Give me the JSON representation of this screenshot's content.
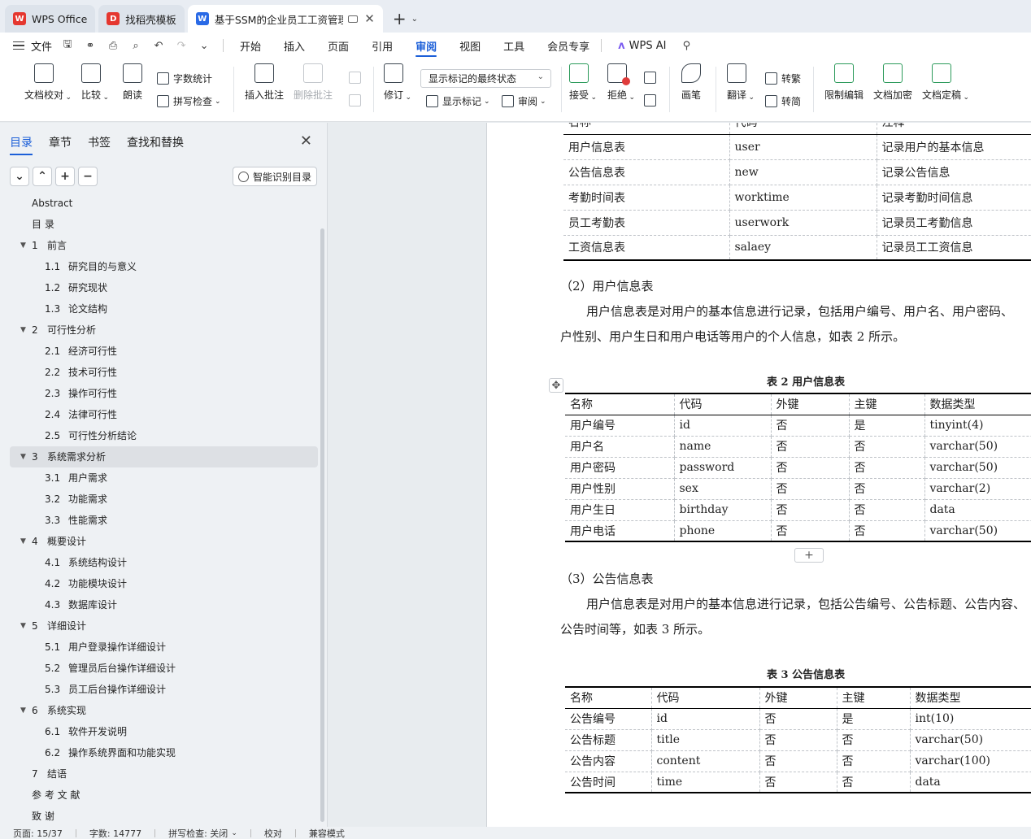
{
  "tabs": [
    {
      "label": "WPS Office",
      "logo": "W",
      "logo_color": "#e5372f"
    },
    {
      "label": "找稻壳模板",
      "logo": "D",
      "logo_color": "#e5372f"
    },
    {
      "label": "基于SSM的企业员工工资管理系",
      "logo": "W",
      "logo_color": "#2a6ae6"
    }
  ],
  "menu": {
    "file": "文件",
    "items": [
      "开始",
      "插入",
      "页面",
      "引用",
      "审阅",
      "视图",
      "工具",
      "会员专享"
    ],
    "active": "审阅",
    "ai": "WPS AI"
  },
  "ribbon": {
    "doc_check": "文档校对",
    "compare": "比较",
    "read_aloud": "朗读",
    "word_count": "字数统计",
    "spell_check": "拼写检查",
    "insert_comment": "插入批注",
    "delete_comment": "删除批注",
    "revise": "修订",
    "markup_state": "显示标记的最终状态",
    "show_markup": "显示标记",
    "review": "审阅",
    "accept": "接受",
    "reject": "拒绝",
    "pen": "画笔",
    "translate": "翻译",
    "to_traditional": "转繁",
    "to_simplified": "转简",
    "restrict_edit": "限制编辑",
    "encrypt": "文档加密",
    "finalize": "文档定稿"
  },
  "nav": {
    "tabs": [
      "目录",
      "章节",
      "书签",
      "查找和替换"
    ],
    "smart_toc": "智能识别目录",
    "items": [
      {
        "num": "",
        "text": "Abstract",
        "level": 1,
        "toggle": false
      },
      {
        "num": "",
        "text": "目        录",
        "level": 1,
        "toggle": false
      },
      {
        "num": "1",
        "text": "前言",
        "level": 1,
        "toggle": true
      },
      {
        "num": "1.1",
        "text": "研究目的与意义",
        "level": 2,
        "toggle": false
      },
      {
        "num": "1.2",
        "text": "研究现状",
        "level": 2,
        "toggle": false
      },
      {
        "num": "1.3",
        "text": "论文结构",
        "level": 2,
        "toggle": false
      },
      {
        "num": "2",
        "text": "可行性分析",
        "level": 1,
        "toggle": true
      },
      {
        "num": "2.1",
        "text": "经济可行性",
        "level": 2,
        "toggle": false
      },
      {
        "num": "2.2",
        "text": "技术可行性",
        "level": 2,
        "toggle": false
      },
      {
        "num": "2.3",
        "text": "操作可行性",
        "level": 2,
        "toggle": false
      },
      {
        "num": "2.4",
        "text": "法律可行性",
        "level": 2,
        "toggle": false
      },
      {
        "num": "2.5",
        "text": "可行性分析结论",
        "level": 2,
        "toggle": false
      },
      {
        "num": "3",
        "text": "系统需求分析",
        "level": 1,
        "toggle": true,
        "selected": true
      },
      {
        "num": "3.1",
        "text": "用户需求",
        "level": 2,
        "toggle": false
      },
      {
        "num": "3.2",
        "text": "功能需求",
        "level": 2,
        "toggle": false
      },
      {
        "num": "3.3",
        "text": "性能需求",
        "level": 2,
        "toggle": false
      },
      {
        "num": "4",
        "text": "概要设计",
        "level": 1,
        "toggle": true
      },
      {
        "num": "4.1",
        "text": "系统结构设计",
        "level": 2,
        "toggle": false
      },
      {
        "num": "4.2",
        "text": "功能模块设计",
        "level": 2,
        "toggle": false
      },
      {
        "num": "4.3",
        "text": "数据库设计",
        "level": 2,
        "toggle": false
      },
      {
        "num": "5",
        "text": "详细设计",
        "level": 1,
        "toggle": true
      },
      {
        "num": "5.1",
        "text": "用户登录操作详细设计",
        "level": 2,
        "toggle": false
      },
      {
        "num": "5.2",
        "text": "管理员后台操作详细设计",
        "level": 2,
        "toggle": false
      },
      {
        "num": "5.3",
        "text": "员工后台操作详细设计",
        "level": 2,
        "toggle": false
      },
      {
        "num": "6",
        "text": "系统实现",
        "level": 1,
        "toggle": true
      },
      {
        "num": "6.1",
        "text": "软件开发说明",
        "level": 2,
        "toggle": false
      },
      {
        "num": "6.2",
        "text": "操作系统界面和功能实现",
        "level": 2,
        "toggle": false
      },
      {
        "num": "7",
        "text": "结语",
        "level": 1,
        "toggle": false
      },
      {
        "num": "",
        "text": "参  考  文  献",
        "level": 1,
        "toggle": false
      },
      {
        "num": "",
        "text": "致        谢",
        "level": 1,
        "toggle": false
      }
    ]
  },
  "doc": {
    "table1": {
      "header": [
        "名称",
        "代码",
        "注释"
      ],
      "rows": [
        [
          "用户信息表",
          "user",
          "记录用户的基本信息"
        ],
        [
          "公告信息表",
          "new",
          "记录公告信息"
        ],
        [
          "考勤时间表",
          "worktime",
          "记录考勤时间信息"
        ],
        [
          "员工考勤表",
          "userwork",
          "记录员工考勤信息"
        ],
        [
          "工资信息表",
          "salaey",
          "记录员工工资信息"
        ]
      ]
    },
    "section2_heading": "（2）用户信息表",
    "section2_para1": "用户信息表是对用户的基本信息进行记录，包括用户编号、用户名、用户密码、",
    "section2_para2": "户性别、用户生日和用户电话等用户的个人信息，如表 2 所示。",
    "table2_caption": "表 2  用户信息表",
    "table2": {
      "header": [
        "名称",
        "代码",
        "外键",
        "主键",
        "数据类型"
      ],
      "rows": [
        [
          "用户编号",
          "id",
          "否",
          "是",
          "tinyint(4)"
        ],
        [
          "用户名",
          "name",
          "否",
          "否",
          "varchar(50)"
        ],
        [
          "用户密码",
          "password",
          "否",
          "否",
          "varchar(50)"
        ],
        [
          "用户性别",
          "sex",
          "否",
          "否",
          "varchar(2)"
        ],
        [
          "用户生日",
          "birthday",
          "否",
          "否",
          "data"
        ],
        [
          "用户电话",
          "phone",
          "否",
          "否",
          "varchar(50)"
        ]
      ]
    },
    "section3_heading": "（3）公告信息表",
    "section3_para1": "用户信息表是对用户的基本信息进行记录，包括公告编号、公告标题、公告内容、",
    "section3_para2": "公告时间等，如表 3 所示。",
    "table3_caption": "表 3  公告信息表",
    "table3": {
      "header": [
        "名称",
        "代码",
        "外键",
        "主键",
        "数据类型"
      ],
      "rows": [
        [
          "公告编号",
          "id",
          "否",
          "是",
          "int(10)"
        ],
        [
          "公告标题",
          "title",
          "否",
          "否",
          "varchar(50)"
        ],
        [
          "公告内容",
          "content",
          "否",
          "否",
          "varchar(100)"
        ],
        [
          "公告时间",
          "time",
          "否",
          "否",
          "data"
        ]
      ]
    }
  },
  "status": {
    "page": "页面: 15/37",
    "words": "字数: 14777",
    "spell": "拼写检查: 关闭",
    "proof": "校对",
    "compat": "兼容模式"
  },
  "colors": {
    "accent": "#1c5fd8",
    "wps_red": "#e5372f",
    "ai_purple": "#7b5cf0"
  }
}
